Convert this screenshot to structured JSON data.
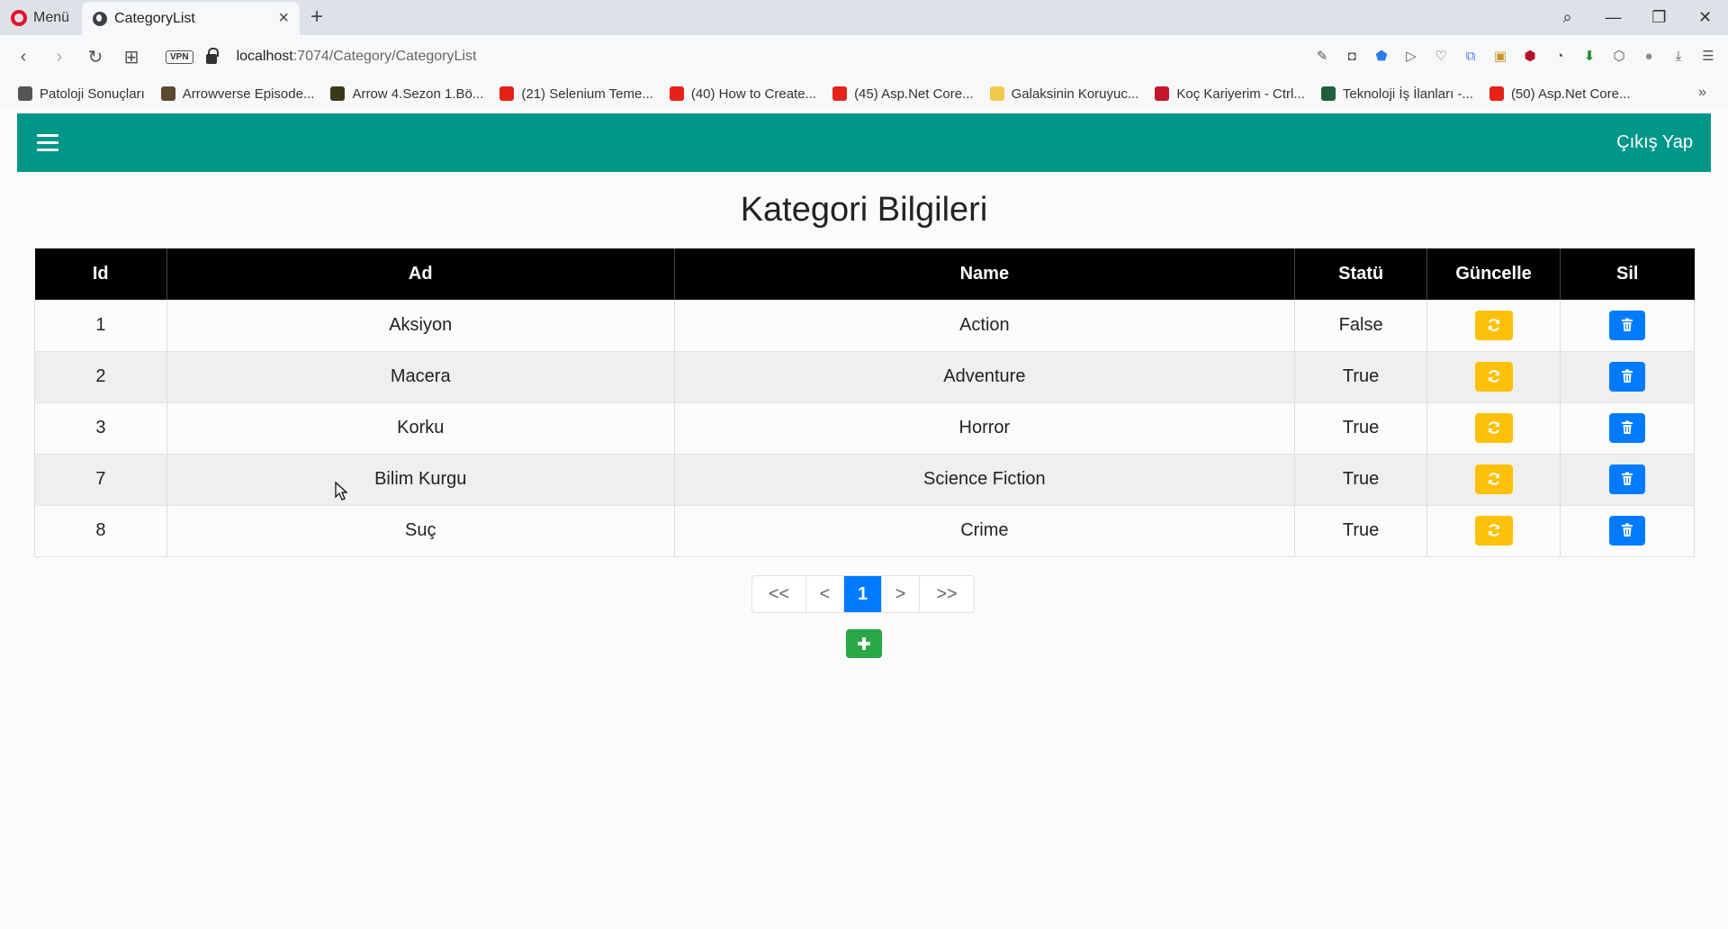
{
  "browser": {
    "menu_label": "Menü",
    "tab_title": "CategoryList",
    "url_host": "localhost",
    "url_path": ":7074/Category/CategoryList",
    "vpn_label": "VPN",
    "bookmarks": [
      {
        "label": "Patoloji Sonuçları",
        "color": "#555555"
      },
      {
        "label": "Arrowverse Episode...",
        "color": "#5b4a2f"
      },
      {
        "label": "Arrow 4.Sezon 1.Bö...",
        "color": "#3a3a1a"
      },
      {
        "label": "(21) Selenium Teme...",
        "color": "#e62117"
      },
      {
        "label": "(40) How to Create...",
        "color": "#e62117"
      },
      {
        "label": "(45) Asp.Net Core...",
        "color": "#e62117"
      },
      {
        "label": "Galaksinin Koruyuc...",
        "color": "#f2c94c"
      },
      {
        "label": "Koç Kariyerim - Ctrl...",
        "color": "#c4162a"
      },
      {
        "label": "Teknoloji İş İlanları -...",
        "color": "#1f5f3a"
      },
      {
        "label": "(50) Asp.Net Core...",
        "color": "#e62117"
      }
    ]
  },
  "navbar": {
    "logout_label": "Çıkış Yap",
    "color": "#009688"
  },
  "page_title": "Kategori Bilgileri",
  "table": {
    "headers": {
      "id": "Id",
      "ad": "Ad",
      "name": "Name",
      "status": "Statü",
      "update": "Güncelle",
      "delete": "Sil"
    },
    "rows": [
      {
        "id": "1",
        "ad": "Aksiyon",
        "name": "Action",
        "status": "False"
      },
      {
        "id": "2",
        "ad": "Macera",
        "name": "Adventure",
        "status": "True"
      },
      {
        "id": "3",
        "ad": "Korku",
        "name": "Horror",
        "status": "True"
      },
      {
        "id": "7",
        "ad": "Bilim Kurgu",
        "name": "Science Fiction",
        "status": "True"
      },
      {
        "id": "8",
        "ad": "Suç",
        "name": "Crime",
        "status": "True"
      }
    ]
  },
  "pagination": {
    "first": "<<",
    "prev": "<",
    "current": "1",
    "next": ">",
    "last": ">>"
  },
  "colors": {
    "update_button": "#ffc107",
    "delete_button": "#007bff",
    "add_button": "#28a745"
  }
}
